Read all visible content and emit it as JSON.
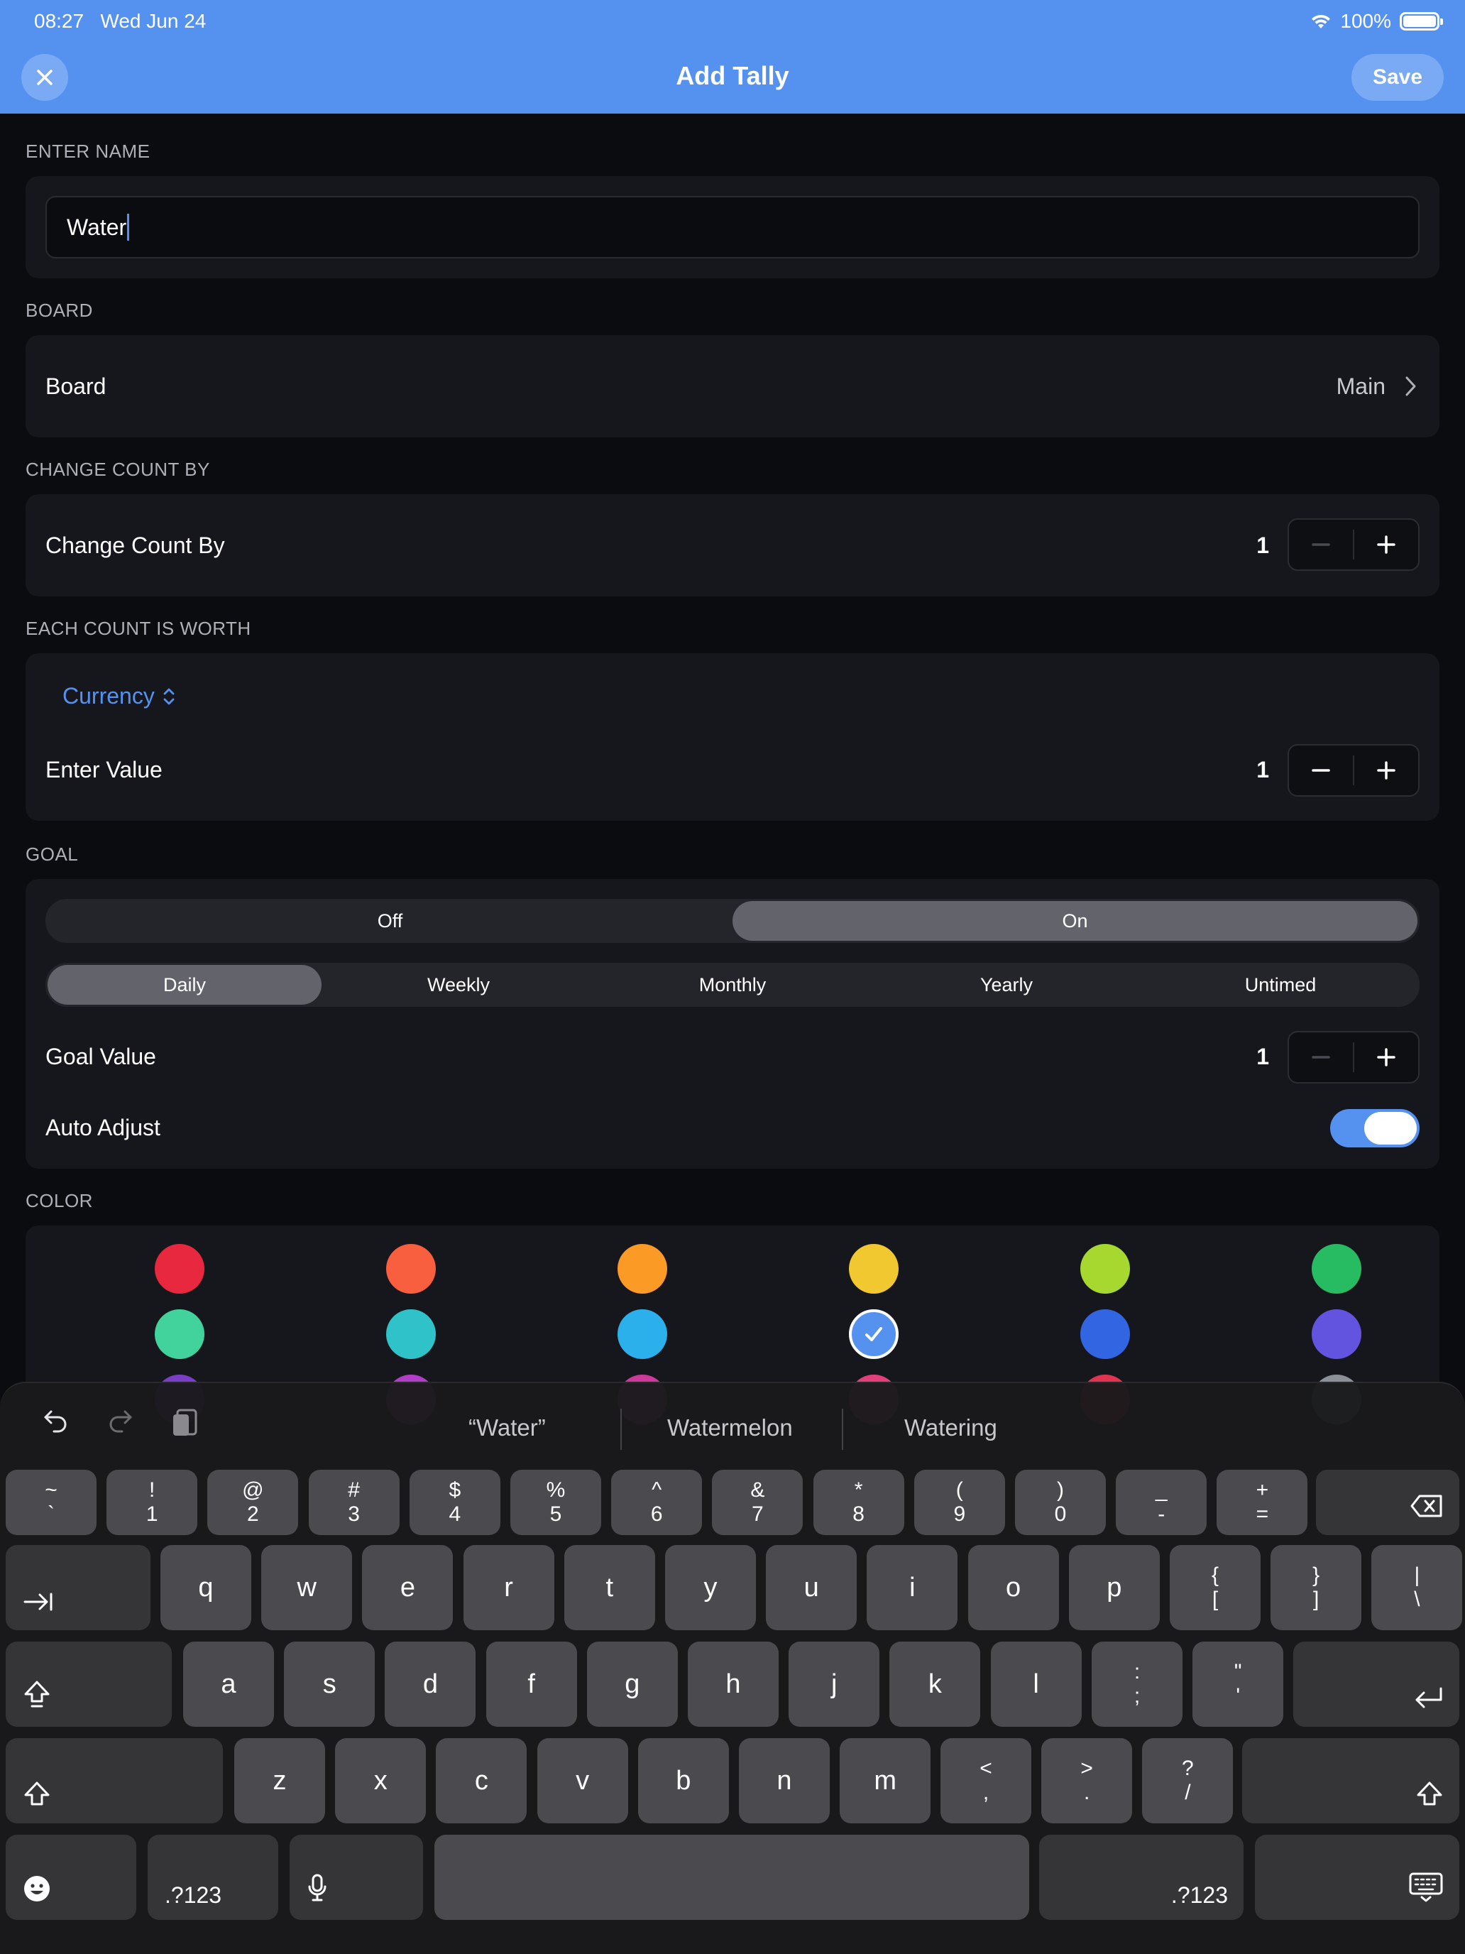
{
  "status_bar": {
    "time": "08:27",
    "date": "Wed Jun 24",
    "battery": "100%"
  },
  "nav": {
    "title": "Add Tally",
    "save_label": "Save",
    "close_icon": "close-icon"
  },
  "name_section": {
    "label": "ENTER NAME",
    "value": "Water"
  },
  "board_section": {
    "label": "BOARD",
    "row_label": "Board",
    "row_value": "Main"
  },
  "change_section": {
    "label": "CHANGE COUNT BY",
    "row_label": "Change Count By",
    "value": "1"
  },
  "worth_section": {
    "label": "EACH COUNT IS WORTH",
    "currency_label": "Currency",
    "row_label": "Enter Value",
    "value": "1"
  },
  "goal_section": {
    "label": "GOAL",
    "toggle_options": [
      "Off",
      "On"
    ],
    "toggle_selected": "On",
    "period_options": [
      "Daily",
      "Weekly",
      "Monthly",
      "Yearly",
      "Untimed"
    ],
    "period_selected": "Daily",
    "goal_label": "Goal Value",
    "goal_value": "1",
    "auto_label": "Auto Adjust",
    "auto_on": true
  },
  "color_section": {
    "label": "COLOR",
    "colors": [
      "#e8283f",
      "#f75f3f",
      "#fb9a25",
      "#f2c830",
      "#a6d830",
      "#28bc62",
      "#41d39b",
      "#2fc3c9",
      "#2bb0ec",
      "#5592f0",
      "#3165e2",
      "#6354e0",
      "#7a3fc6",
      "#b13ec6",
      "#cc3a9a",
      "#e2407a",
      "#e03451",
      "#8b9099"
    ],
    "selected_color": "#5592f0"
  },
  "keyboard": {
    "suggestions": [
      "“Water”",
      "Watermelon",
      "Watering"
    ],
    "number_row": [
      {
        "top": "~",
        "bottom": "`"
      },
      {
        "top": "!",
        "bottom": "1"
      },
      {
        "top": "@",
        "bottom": "2"
      },
      {
        "top": "#",
        "bottom": "3"
      },
      {
        "top": "$",
        "bottom": "4"
      },
      {
        "top": "%",
        "bottom": "5"
      },
      {
        "top": "^",
        "bottom": "6"
      },
      {
        "top": "&",
        "bottom": "7"
      },
      {
        "top": "*",
        "bottom": "8"
      },
      {
        "top": "(",
        "bottom": "9"
      },
      {
        "top": ")",
        "bottom": "0"
      },
      {
        "top": "_",
        "bottom": "-"
      },
      {
        "top": "+",
        "bottom": "="
      }
    ],
    "row_q": [
      "q",
      "w",
      "e",
      "r",
      "t",
      "y",
      "u",
      "i",
      "o",
      "p"
    ],
    "row_q_extra": [
      {
        "top": "{",
        "bottom": "["
      },
      {
        "top": "}",
        "bottom": "]"
      },
      {
        "top": "|",
        "bottom": "\\"
      }
    ],
    "row_a": [
      "a",
      "s",
      "d",
      "f",
      "g",
      "h",
      "j",
      "k",
      "l"
    ],
    "row_a_extra": [
      {
        "top": ":",
        "bottom": ";"
      },
      {
        "top": "\"",
        "bottom": "'"
      }
    ],
    "row_z": [
      "z",
      "x",
      "c",
      "v",
      "b",
      "n",
      "m"
    ],
    "row_z_extra": [
      {
        "top": "<",
        "bottom": ","
      },
      {
        "top": ">",
        "bottom": "."
      },
      {
        "top": "?",
        "bottom": "/"
      }
    ],
    "numbers_label": ".?123"
  }
}
